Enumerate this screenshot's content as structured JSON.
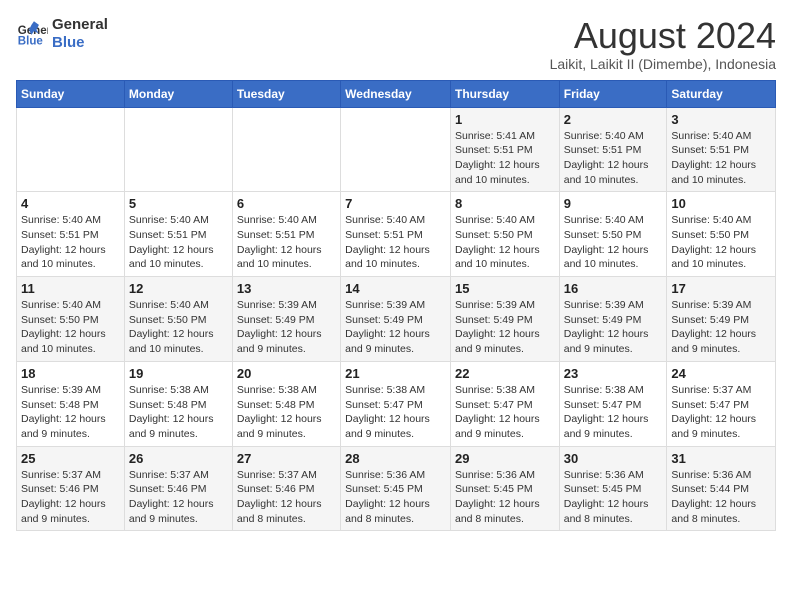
{
  "logo": {
    "line1": "General",
    "line2": "Blue"
  },
  "header": {
    "month": "August 2024",
    "location": "Laikit, Laikit II (Dimembe), Indonesia"
  },
  "weekdays": [
    "Sunday",
    "Monday",
    "Tuesday",
    "Wednesday",
    "Thursday",
    "Friday",
    "Saturday"
  ],
  "weeks": [
    [
      {
        "day": "",
        "info": ""
      },
      {
        "day": "",
        "info": ""
      },
      {
        "day": "",
        "info": ""
      },
      {
        "day": "",
        "info": ""
      },
      {
        "day": "1",
        "info": "Sunrise: 5:41 AM\nSunset: 5:51 PM\nDaylight: 12 hours\nand 10 minutes."
      },
      {
        "day": "2",
        "info": "Sunrise: 5:40 AM\nSunset: 5:51 PM\nDaylight: 12 hours\nand 10 minutes."
      },
      {
        "day": "3",
        "info": "Sunrise: 5:40 AM\nSunset: 5:51 PM\nDaylight: 12 hours\nand 10 minutes."
      }
    ],
    [
      {
        "day": "4",
        "info": "Sunrise: 5:40 AM\nSunset: 5:51 PM\nDaylight: 12 hours\nand 10 minutes."
      },
      {
        "day": "5",
        "info": "Sunrise: 5:40 AM\nSunset: 5:51 PM\nDaylight: 12 hours\nand 10 minutes."
      },
      {
        "day": "6",
        "info": "Sunrise: 5:40 AM\nSunset: 5:51 PM\nDaylight: 12 hours\nand 10 minutes."
      },
      {
        "day": "7",
        "info": "Sunrise: 5:40 AM\nSunset: 5:51 PM\nDaylight: 12 hours\nand 10 minutes."
      },
      {
        "day": "8",
        "info": "Sunrise: 5:40 AM\nSunset: 5:50 PM\nDaylight: 12 hours\nand 10 minutes."
      },
      {
        "day": "9",
        "info": "Sunrise: 5:40 AM\nSunset: 5:50 PM\nDaylight: 12 hours\nand 10 minutes."
      },
      {
        "day": "10",
        "info": "Sunrise: 5:40 AM\nSunset: 5:50 PM\nDaylight: 12 hours\nand 10 minutes."
      }
    ],
    [
      {
        "day": "11",
        "info": "Sunrise: 5:40 AM\nSunset: 5:50 PM\nDaylight: 12 hours\nand 10 minutes."
      },
      {
        "day": "12",
        "info": "Sunrise: 5:40 AM\nSunset: 5:50 PM\nDaylight: 12 hours\nand 10 minutes."
      },
      {
        "day": "13",
        "info": "Sunrise: 5:39 AM\nSunset: 5:49 PM\nDaylight: 12 hours\nand 9 minutes."
      },
      {
        "day": "14",
        "info": "Sunrise: 5:39 AM\nSunset: 5:49 PM\nDaylight: 12 hours\nand 9 minutes."
      },
      {
        "day": "15",
        "info": "Sunrise: 5:39 AM\nSunset: 5:49 PM\nDaylight: 12 hours\nand 9 minutes."
      },
      {
        "day": "16",
        "info": "Sunrise: 5:39 AM\nSunset: 5:49 PM\nDaylight: 12 hours\nand 9 minutes."
      },
      {
        "day": "17",
        "info": "Sunrise: 5:39 AM\nSunset: 5:49 PM\nDaylight: 12 hours\nand 9 minutes."
      }
    ],
    [
      {
        "day": "18",
        "info": "Sunrise: 5:39 AM\nSunset: 5:48 PM\nDaylight: 12 hours\nand 9 minutes."
      },
      {
        "day": "19",
        "info": "Sunrise: 5:38 AM\nSunset: 5:48 PM\nDaylight: 12 hours\nand 9 minutes."
      },
      {
        "day": "20",
        "info": "Sunrise: 5:38 AM\nSunset: 5:48 PM\nDaylight: 12 hours\nand 9 minutes."
      },
      {
        "day": "21",
        "info": "Sunrise: 5:38 AM\nSunset: 5:47 PM\nDaylight: 12 hours\nand 9 minutes."
      },
      {
        "day": "22",
        "info": "Sunrise: 5:38 AM\nSunset: 5:47 PM\nDaylight: 12 hours\nand 9 minutes."
      },
      {
        "day": "23",
        "info": "Sunrise: 5:38 AM\nSunset: 5:47 PM\nDaylight: 12 hours\nand 9 minutes."
      },
      {
        "day": "24",
        "info": "Sunrise: 5:37 AM\nSunset: 5:47 PM\nDaylight: 12 hours\nand 9 minutes."
      }
    ],
    [
      {
        "day": "25",
        "info": "Sunrise: 5:37 AM\nSunset: 5:46 PM\nDaylight: 12 hours\nand 9 minutes."
      },
      {
        "day": "26",
        "info": "Sunrise: 5:37 AM\nSunset: 5:46 PM\nDaylight: 12 hours\nand 9 minutes."
      },
      {
        "day": "27",
        "info": "Sunrise: 5:37 AM\nSunset: 5:46 PM\nDaylight: 12 hours\nand 8 minutes."
      },
      {
        "day": "28",
        "info": "Sunrise: 5:36 AM\nSunset: 5:45 PM\nDaylight: 12 hours\nand 8 minutes."
      },
      {
        "day": "29",
        "info": "Sunrise: 5:36 AM\nSunset: 5:45 PM\nDaylight: 12 hours\nand 8 minutes."
      },
      {
        "day": "30",
        "info": "Sunrise: 5:36 AM\nSunset: 5:45 PM\nDaylight: 12 hours\nand 8 minutes."
      },
      {
        "day": "31",
        "info": "Sunrise: 5:36 AM\nSunset: 5:44 PM\nDaylight: 12 hours\nand 8 minutes."
      }
    ]
  ]
}
